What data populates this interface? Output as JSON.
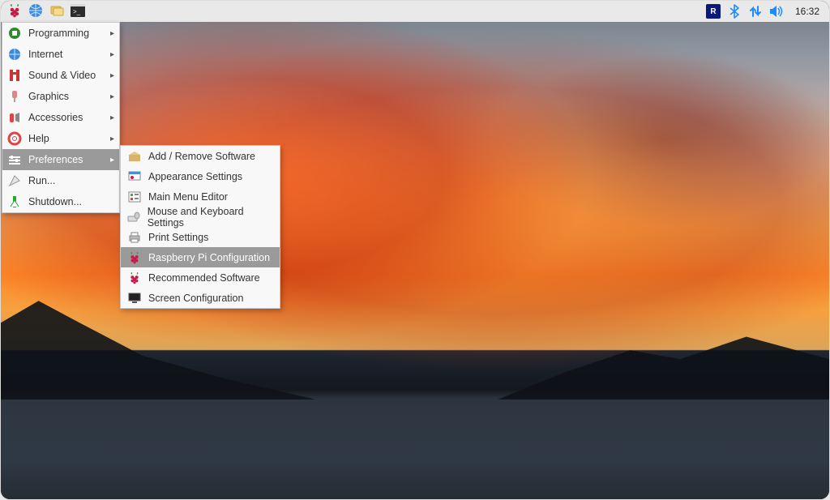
{
  "panel": {
    "clock": "16:32",
    "launchers": [
      {
        "name": "raspberry-menu",
        "icon": "raspberry"
      },
      {
        "name": "web-browser",
        "icon": "globe"
      },
      {
        "name": "file-manager",
        "icon": "folders"
      },
      {
        "name": "terminal",
        "icon": "terminal"
      }
    ],
    "tray": [
      {
        "name": "vnc",
        "icon": "vnc"
      },
      {
        "name": "bluetooth",
        "icon": "bluetooth"
      },
      {
        "name": "network",
        "icon": "network"
      },
      {
        "name": "volume",
        "icon": "volume"
      }
    ]
  },
  "menu": {
    "items": [
      {
        "label": "Programming",
        "icon": "programming",
        "has_submenu": true
      },
      {
        "label": "Internet",
        "icon": "internet",
        "has_submenu": true
      },
      {
        "label": "Sound & Video",
        "icon": "sound-video",
        "has_submenu": true
      },
      {
        "label": "Graphics",
        "icon": "graphics",
        "has_submenu": true
      },
      {
        "label": "Accessories",
        "icon": "accessories",
        "has_submenu": true
      },
      {
        "label": "Help",
        "icon": "help",
        "has_submenu": true
      },
      {
        "label": "Preferences",
        "icon": "preferences",
        "has_submenu": true,
        "highlighted": true
      },
      {
        "label": "Run...",
        "icon": "run",
        "has_submenu": false
      },
      {
        "label": "Shutdown...",
        "icon": "shutdown",
        "has_submenu": false
      }
    ]
  },
  "submenu": {
    "title": "Preferences",
    "items": [
      {
        "label": "Add / Remove Software",
        "icon": "package"
      },
      {
        "label": "Appearance Settings",
        "icon": "appearance"
      },
      {
        "label": "Main Menu Editor",
        "icon": "menu-editor"
      },
      {
        "label": "Mouse and Keyboard Settings",
        "icon": "mouse-keyboard"
      },
      {
        "label": "Print Settings",
        "icon": "printer"
      },
      {
        "label": "Raspberry Pi Configuration",
        "icon": "raspberry",
        "highlighted": true
      },
      {
        "label": "Recommended Software",
        "icon": "raspberry"
      },
      {
        "label": "Screen Configuration",
        "icon": "monitor"
      }
    ]
  },
  "colors": {
    "accent_blue": "#1b8cff",
    "rpi_red": "#c51a4a",
    "highlight_grey": "#9a9a9a"
  }
}
